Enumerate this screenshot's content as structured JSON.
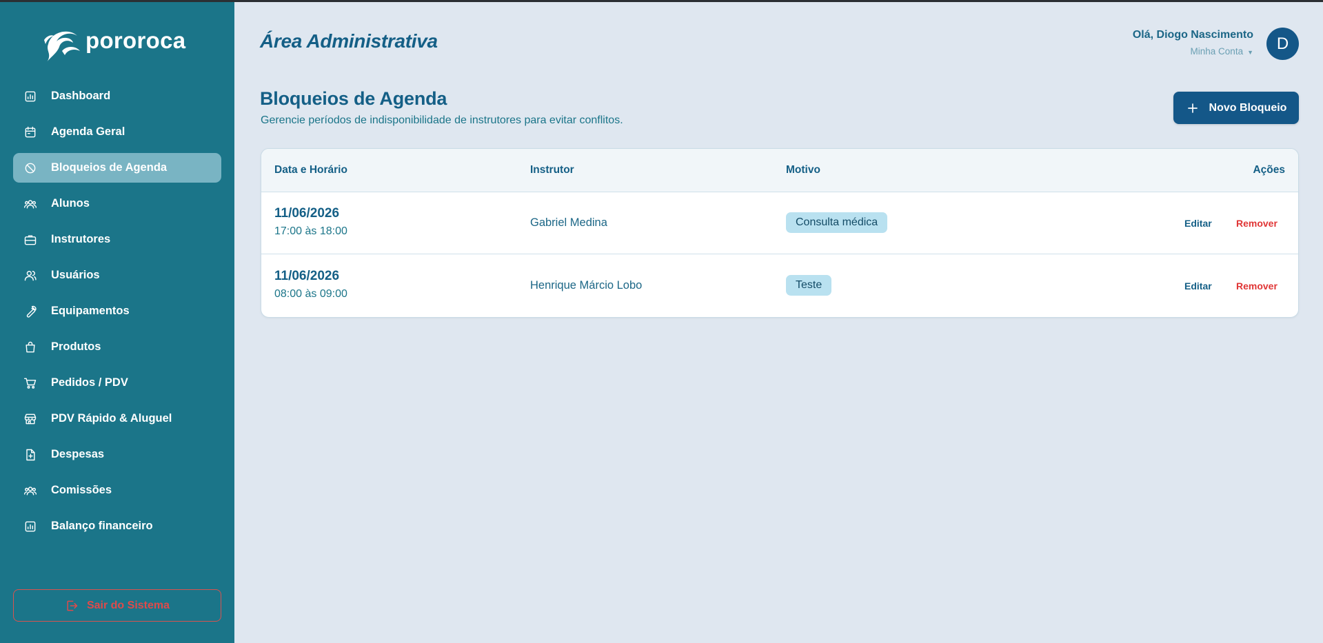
{
  "brand": {
    "name": "pororoca"
  },
  "sidebar": {
    "items": [
      {
        "label": "Dashboard",
        "icon": "bar-chart-icon"
      },
      {
        "label": "Agenda Geral",
        "icon": "calendar-icon"
      },
      {
        "label": "Bloqueios de Agenda",
        "icon": "ban-icon",
        "active": true
      },
      {
        "label": "Alunos",
        "icon": "users-group-icon"
      },
      {
        "label": "Instrutores",
        "icon": "briefcase-icon"
      },
      {
        "label": "Usuários",
        "icon": "user-icon"
      },
      {
        "label": "Equipamentos",
        "icon": "wrench-icon"
      },
      {
        "label": "Produtos",
        "icon": "shopping-bag-icon"
      },
      {
        "label": "Pedidos / PDV",
        "icon": "cart-icon"
      },
      {
        "label": "PDV Rápido & Aluguel",
        "icon": "store-icon"
      },
      {
        "label": "Despesas",
        "icon": "file-plus-icon"
      },
      {
        "label": "Comissões",
        "icon": "users-group-icon"
      },
      {
        "label": "Balanço financeiro",
        "icon": "bar-chart-icon"
      }
    ],
    "logout_label": "Sair do Sistema"
  },
  "header": {
    "area_title": "Área Administrativa",
    "greeting": "Olá, Diogo Nascimento",
    "account_label": "Minha Conta",
    "avatar_initial": "D"
  },
  "page": {
    "title": "Bloqueios de Agenda",
    "subtitle": "Gerencie períodos de indisponibilidade de instrutores para evitar conflitos.",
    "new_button_label": "Novo Bloqueio"
  },
  "table": {
    "columns": [
      "Data e Horário",
      "Instrutor",
      "Motivo",
      "Ações"
    ],
    "rows": [
      {
        "date": "11/06/2026",
        "time": "17:00 às 18:00",
        "instructor": "Gabriel Medina",
        "reason": "Consulta médica",
        "edit": "Editar",
        "remove": "Remover"
      },
      {
        "date": "11/06/2026",
        "time": "08:00 às 09:00",
        "instructor": "Henrique Márcio Lobo",
        "reason": "Teste",
        "edit": "Editar",
        "remove": "Remover"
      }
    ]
  },
  "colors": {
    "sidebar_bg": "#1b7589",
    "sidebar_active": "#79b4c3",
    "primary": "#145788",
    "page_bg": "#dfe7f0",
    "danger": "#e03535",
    "badge_bg": "#b9e1f0"
  }
}
